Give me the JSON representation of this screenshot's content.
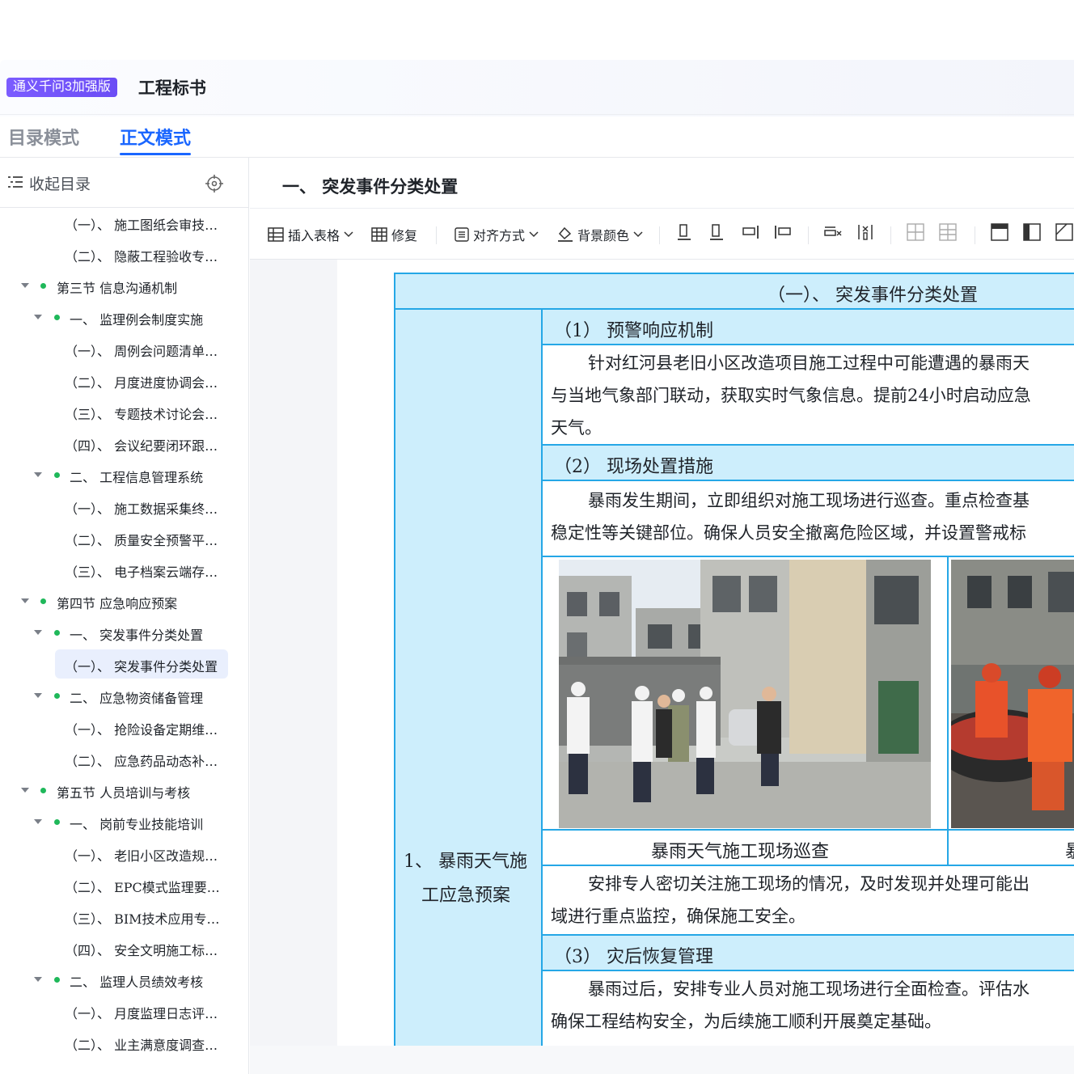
{
  "app": {
    "model_badge": "通义千问3加强版",
    "title": "工程标书"
  },
  "mode_tabs": [
    {
      "label": "目录模式",
      "active": false
    },
    {
      "label": "正文模式",
      "active": true
    }
  ],
  "sidebar": {
    "header_label": "收起目录",
    "items": [
      {
        "level": 3,
        "text": "（一）、 施工图纸会审技…"
      },
      {
        "level": 3,
        "text": "（二）、 隐蔽工程验收专…"
      },
      {
        "level": 1,
        "text": "第三节 信息沟通机制"
      },
      {
        "level": 2,
        "text": "一、 监理例会制度实施"
      },
      {
        "level": 3,
        "text": "（一）、 周例会问题清单…"
      },
      {
        "level": 3,
        "text": "（二）、 月度进度协调会…"
      },
      {
        "level": 3,
        "text": "（三）、 专题技术讨论会…"
      },
      {
        "level": 3,
        "text": "（四）、 会议纪要闭环跟…"
      },
      {
        "level": 2,
        "text": "二、 工程信息管理系统"
      },
      {
        "level": 3,
        "text": "（一）、 施工数据采集终…"
      },
      {
        "level": 3,
        "text": "（二）、 质量安全预警平…"
      },
      {
        "level": 3,
        "text": "（三）、 电子档案云端存…"
      },
      {
        "level": 1,
        "text": "第四节 应急响应预案"
      },
      {
        "level": 2,
        "text": "一、 突发事件分类处置"
      },
      {
        "level": 3,
        "text": "（一）、 突发事件分类处置",
        "selected": true
      },
      {
        "level": 2,
        "text": "二、 应急物资储备管理"
      },
      {
        "level": 3,
        "text": "（一）、 抢险设备定期维…"
      },
      {
        "level": 3,
        "text": "（二）、 应急药品动态补…"
      },
      {
        "level": 1,
        "text": "第五节 人员培训与考核"
      },
      {
        "level": 2,
        "text": "一、 岗前专业技能培训"
      },
      {
        "level": 3,
        "text": "（一）、 老旧小区改造规…"
      },
      {
        "level": 3,
        "text": "（二）、 EPC模式监理要…"
      },
      {
        "level": 3,
        "text": "（三）、 BIM技术应用专…"
      },
      {
        "level": 3,
        "text": "（四）、 安全文明施工标…"
      },
      {
        "level": 2,
        "text": "二、 监理人员绩效考核"
      },
      {
        "level": 3,
        "text": "（一）、 月度监理日志评…"
      },
      {
        "level": 3,
        "text": "（二）、 业主满意度调查…"
      }
    ]
  },
  "document": {
    "section_title": "一、 突发事件分类处置",
    "toolbar": {
      "insert_table": "插入表格",
      "repair": "修复",
      "align": "对齐方式",
      "bg_color": "背景颜色"
    },
    "table": {
      "header": "（一）、 突发事件分类处置",
      "row_label_line1": "1、 暴雨天气施",
      "row_label_line2": "工应急预案",
      "sub1_title": "（1） 预警响应机制",
      "sub1_line1": "针对红河县老旧小区改造项目施工过程中可能遭遇的暴雨天",
      "sub1_line2": "与当地气象部门联动，获取实时气象信息。提前24小时启动应急",
      "sub1_line3": "天气。",
      "sub2_title": "（2） 现场处置措施",
      "sub2_line1": "暴雨发生期间，立即组织对施工现场进行巡查。重点检查基",
      "sub2_line2": "稳定性等关键部位。确保人员安全撤离危险区域，并设置警戒标",
      "photo1_caption": "暴雨天气施工现场巡查",
      "photo2_caption": "暴",
      "sub2_line3": "安排专人密切关注施工现场的情况，及时发现并处理可能出",
      "sub2_line4": "域进行重点监控，确保施工安全。",
      "sub3_title": "（3） 灾后恢复管理",
      "sub3_line1": "暴雨过后，安排专业人员对施工现场进行全面检查。评估水",
      "sub3_line2": "确保工程结构安全，为后续施工顺利开展奠定基础。"
    }
  },
  "colors": {
    "accent": "#1a66ff",
    "badge": "#6b4df5",
    "table_border": "#25a7e6",
    "table_fill": "#cdeefc",
    "tree_dot": "#1fb85a"
  }
}
